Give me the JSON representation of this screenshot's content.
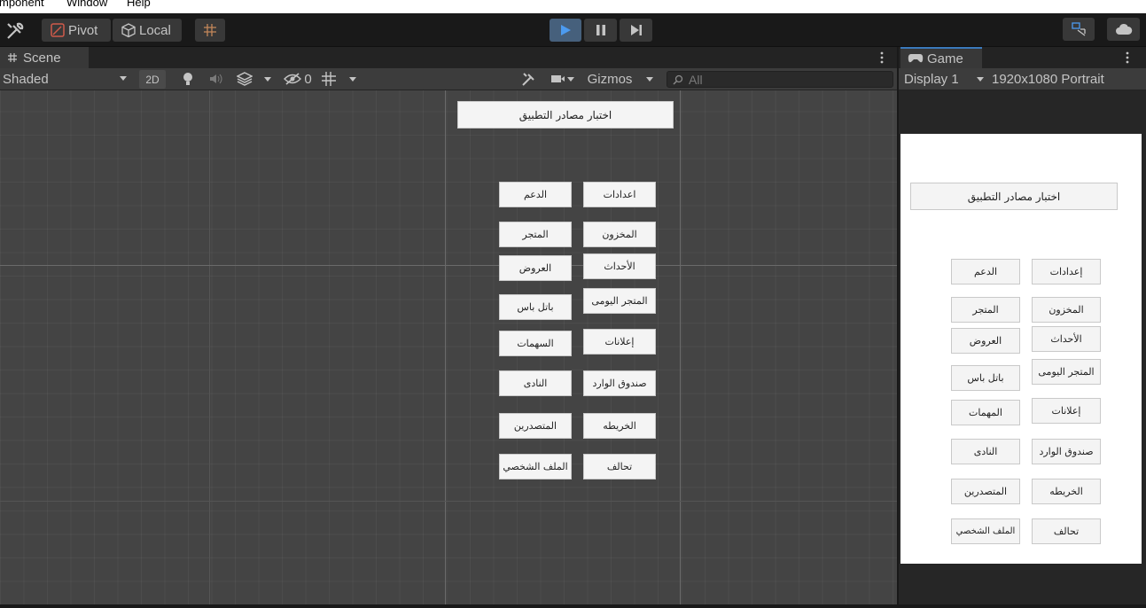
{
  "menubar": {
    "items": [
      "mponent",
      "Window",
      "Help"
    ]
  },
  "toolbar": {
    "pivot_label": "Pivot",
    "local_label": "Local",
    "accent": "#3a79bb"
  },
  "scene": {
    "tab_label": "Scene",
    "shading_mode": "Shaded",
    "mode_2d": "2D",
    "hidden_count": "0",
    "gizmos_label": "Gizmos",
    "search_placeholder": "All"
  },
  "game": {
    "tab_label": "Game",
    "display": "Display 1",
    "resolution": "1920x1080 Portrait"
  },
  "canvas": {
    "title": "اختبار مصادر التطبيق",
    "scene_buttons": {
      "settings": "اعدادات",
      "support": "الدعم",
      "inventory": "المخزون",
      "store": "المتجر",
      "events": "الأحداث",
      "offers": "العروض",
      "daily_store": "المتجر اليومى",
      "battle_pass": "باتل باس",
      "ads": "إعلانات",
      "missions": "السهمات",
      "inbox": "صندوق الوارد",
      "club": "النادى",
      "map": "الخريطه",
      "leaders": "المتصدرين",
      "alliance": "تحالف",
      "profile": "الملف الشخصي"
    },
    "game_buttons": {
      "settings": "إعدادات",
      "missions": "المهمات"
    }
  }
}
